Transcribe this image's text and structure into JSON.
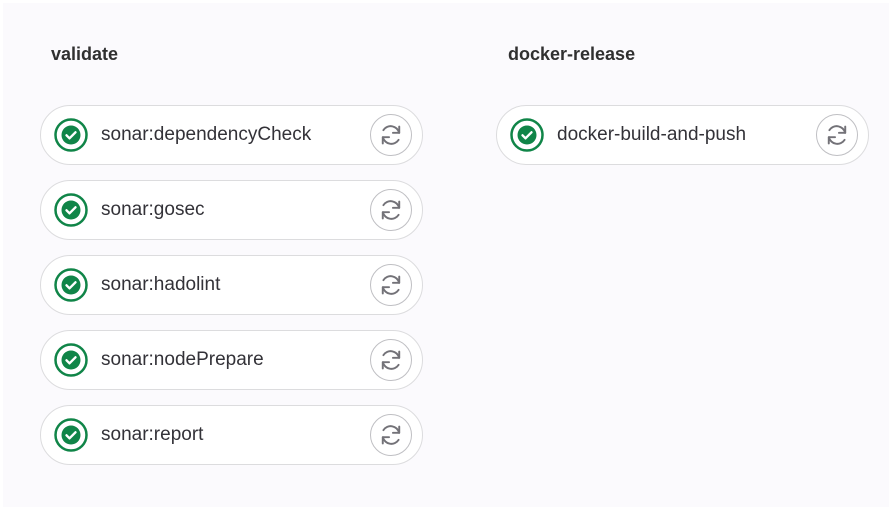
{
  "colors": {
    "success": "#108548",
    "retry_icon": "#737278"
  },
  "stages": [
    {
      "title": "validate",
      "jobs": [
        {
          "name": "sonar:dependencyCheck",
          "status": "success",
          "status_icon": "check-circle-icon",
          "action_icon": "retry-icon"
        },
        {
          "name": "sonar:gosec",
          "status": "success",
          "status_icon": "check-circle-icon",
          "action_icon": "retry-icon"
        },
        {
          "name": "sonar:hadolint",
          "status": "success",
          "status_icon": "check-circle-icon",
          "action_icon": "retry-icon"
        },
        {
          "name": "sonar:nodePrepare",
          "status": "success",
          "status_icon": "check-circle-icon",
          "action_icon": "retry-icon"
        },
        {
          "name": "sonar:report",
          "status": "success",
          "status_icon": "check-circle-icon",
          "action_icon": "retry-icon"
        }
      ]
    },
    {
      "title": "docker-release",
      "jobs": [
        {
          "name": "docker-build-and-push",
          "status": "success",
          "status_icon": "check-circle-icon",
          "action_icon": "retry-icon"
        }
      ]
    }
  ]
}
